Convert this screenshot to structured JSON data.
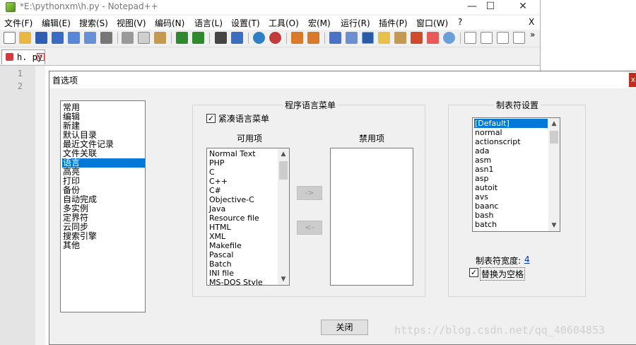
{
  "window": {
    "title": "*E:\\pythonxm\\h.py - Notepad++"
  },
  "window_controls": {
    "minimize": "—",
    "maximize": "☐",
    "close": "✕"
  },
  "menubar": {
    "items": [
      "文件(F)",
      "编辑(E)",
      "搜索(S)",
      "视图(V)",
      "编码(N)",
      "语言(L)",
      "设置(T)",
      "工具(O)",
      "宏(M)",
      "运行(R)",
      "插件(P)",
      "窗口(W)",
      "?"
    ],
    "close": "X"
  },
  "toolbar": {
    "more": "»"
  },
  "file_tab": {
    "label": "h. py",
    "close": "✕",
    "color": "#d13b3b"
  },
  "editor": {
    "line_numbers": [
      "1",
      "2"
    ]
  },
  "dialog": {
    "title": "首选项",
    "close": "x",
    "categories": [
      "常用",
      "编辑",
      "新建",
      "默认目录",
      "最近文件记录",
      "文件关联",
      "语言",
      "高亮",
      "打印",
      "备份",
      "自动完成",
      "多实例",
      "定界符",
      "云同步",
      "搜索引擎",
      "其他"
    ],
    "selected_category": "语言",
    "language_menu": {
      "title": "程序语言菜单",
      "compact_label": "紧凑语言菜单",
      "compact_checked": true,
      "available_label": "可用项",
      "disabled_label": "禁用项",
      "available_items": [
        "Normal Text",
        "PHP",
        "C",
        "C++",
        "C#",
        "Objective-C",
        "Java",
        "Resource file",
        "HTML",
        "XML",
        "Makefile",
        "Pascal",
        "Batch",
        "INI file",
        "MS-DOS Style"
      ],
      "disabled_items": [],
      "move_right": "->",
      "move_left": "<-"
    },
    "tab_settings": {
      "title": "制表符设置",
      "items": [
        "[Default]",
        "normal",
        "actionscript",
        "ada",
        "asm",
        "asn1",
        "asp",
        "autoit",
        "avs",
        "baanc",
        "bash",
        "batch"
      ],
      "selected": "[Default]",
      "width_label": "制表符宽度:",
      "width_value": "4",
      "replace_label": "替换为空格",
      "replace_checked": true
    },
    "close_button": "关闭"
  },
  "watermark": "https://blog.csdn.net/qq_40604853",
  "colors": {
    "selection": "#0078d7",
    "dialog_bg": "#f0f0f0",
    "close_red": "#c42b1c"
  }
}
